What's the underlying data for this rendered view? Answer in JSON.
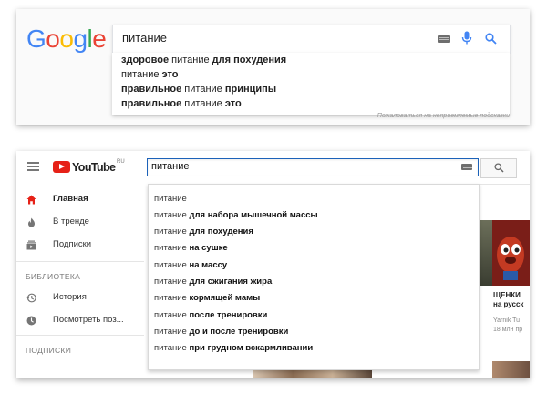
{
  "google": {
    "logo": [
      "G",
      "o",
      "o",
      "g",
      "l",
      "e"
    ],
    "logo_colors": [
      "#4285f4",
      "#ea4335",
      "#fbbc05",
      "#4285f4",
      "#34a853",
      "#ea4335"
    ],
    "query": "питание",
    "suggestions": [
      {
        "parts": [
          [
            "b",
            "здоровое"
          ],
          [
            "n",
            " питание "
          ],
          [
            "b",
            "для похудения"
          ]
        ]
      },
      {
        "parts": [
          [
            "n",
            "питание "
          ],
          [
            "b",
            "это"
          ]
        ]
      },
      {
        "parts": [
          [
            "b",
            "правильное"
          ],
          [
            "n",
            " питание "
          ],
          [
            "b",
            "принципы"
          ]
        ]
      },
      {
        "parts": [
          [
            "b",
            "правильное"
          ],
          [
            "n",
            " питание "
          ],
          [
            "b",
            "это"
          ]
        ]
      }
    ],
    "note": "Пожаловаться на неприемлемые подсказки"
  },
  "youtube": {
    "logo_text": "YouTube",
    "logo_region": "RU",
    "query": "питание",
    "sidebar": {
      "items": [
        {
          "label": "Главная",
          "icon": "home-icon",
          "active": true
        },
        {
          "label": "В тренде",
          "icon": "trending-icon",
          "active": false
        },
        {
          "label": "Подписки",
          "icon": "subscriptions-icon",
          "active": false
        }
      ],
      "library_title": "БИБЛИОТЕКА",
      "library_items": [
        {
          "label": "История",
          "icon": "history-icon"
        },
        {
          "label": "Посмотреть поз...",
          "icon": "watch-later-icon"
        }
      ],
      "subscriptions_title": "ПОДПИСКИ"
    },
    "suggestions": [
      {
        "parts": [
          [
            "n",
            "питание"
          ]
        ]
      },
      {
        "parts": [
          [
            "n",
            "питание "
          ],
          [
            "b",
            "для набора мышечной массы"
          ]
        ]
      },
      {
        "parts": [
          [
            "n",
            "питание "
          ],
          [
            "b",
            "для похудения"
          ]
        ]
      },
      {
        "parts": [
          [
            "n",
            "питание "
          ],
          [
            "b",
            "на сушке"
          ]
        ]
      },
      {
        "parts": [
          [
            "n",
            "питание "
          ],
          [
            "b",
            "на массу"
          ]
        ]
      },
      {
        "parts": [
          [
            "n",
            "питание "
          ],
          [
            "b",
            "для сжигания жира"
          ]
        ]
      },
      {
        "parts": [
          [
            "n",
            "питание "
          ],
          [
            "b",
            "кормящей мамы"
          ]
        ]
      },
      {
        "parts": [
          [
            "n",
            "питание "
          ],
          [
            "b",
            "после тренировки"
          ]
        ]
      },
      {
        "parts": [
          [
            "n",
            "питание "
          ],
          [
            "b",
            "до и после тренировки"
          ]
        ]
      },
      {
        "parts": [
          [
            "n",
            "питание "
          ],
          [
            "b",
            "при грудном вскармливании"
          ]
        ]
      }
    ],
    "video": {
      "title_line1": "ЩЕНКИ",
      "title_line2": "на русск",
      "channel": "Yarnik Tu",
      "views": "18 млн пр"
    }
  }
}
